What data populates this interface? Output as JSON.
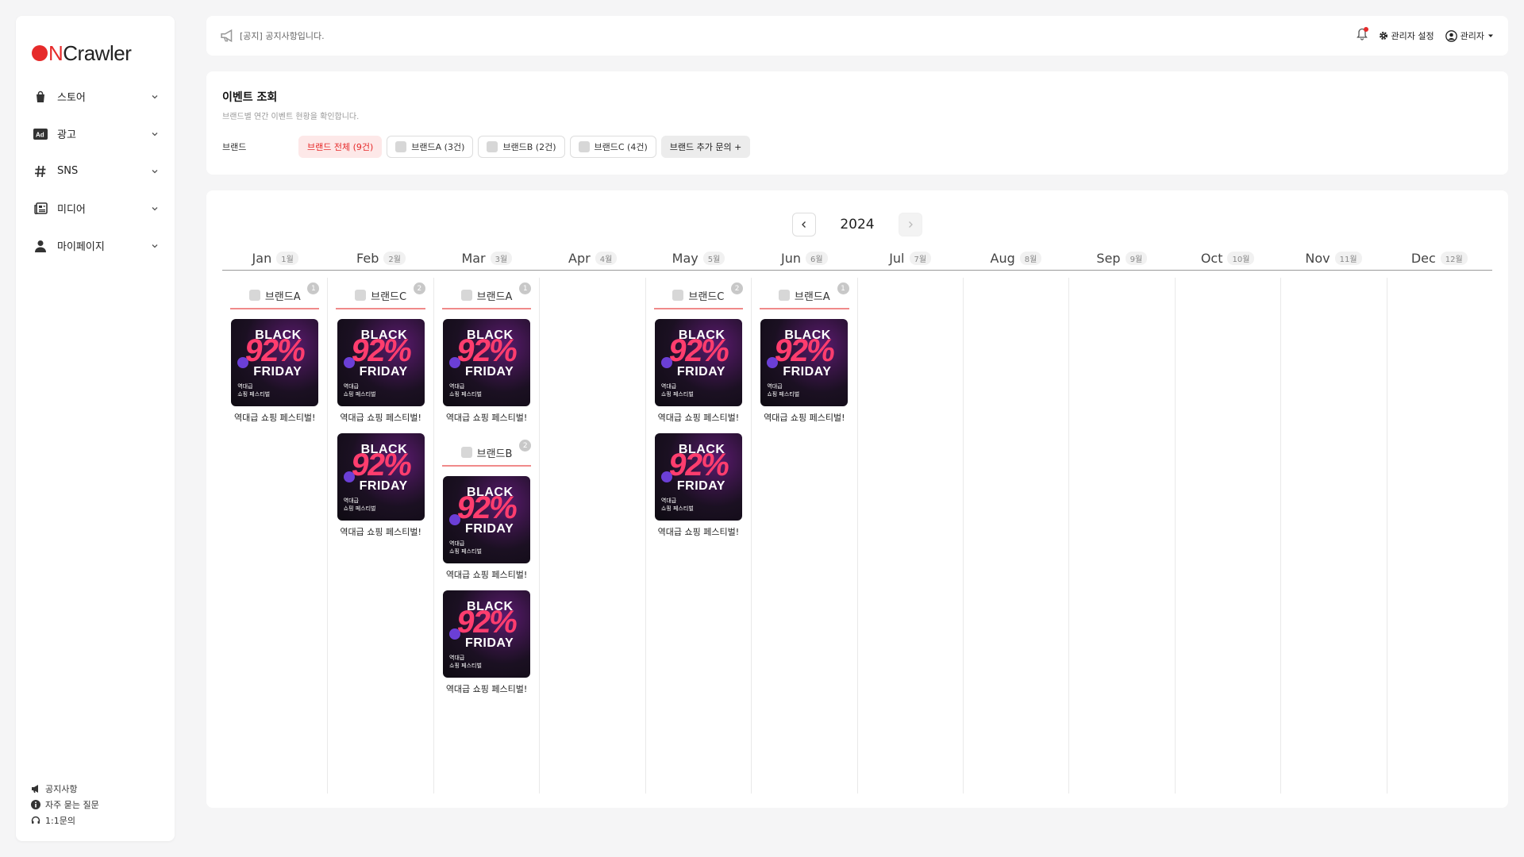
{
  "logo": {
    "n": "N",
    "rest": "Crawler"
  },
  "sidebar": {
    "items": [
      {
        "label": "스토어",
        "icon": "shopping-bag-icon"
      },
      {
        "label": "광고",
        "icon": "ad-icon"
      },
      {
        "label": "SNS",
        "icon": "hashtag-icon"
      },
      {
        "label": "미디어",
        "icon": "newspaper-icon"
      },
      {
        "label": "마이페이지",
        "icon": "user-icon"
      }
    ],
    "footer": [
      {
        "label": "공지사항",
        "icon": "megaphone-icon"
      },
      {
        "label": "자주 묻는 질문",
        "icon": "info-icon"
      },
      {
        "label": "1:1문의",
        "icon": "headset-icon"
      }
    ]
  },
  "topbar": {
    "notice": "[공지] 공지사항입니다.",
    "settings": "관리자 설정",
    "user": "관리자"
  },
  "filter": {
    "title": "이벤트 조회",
    "subtitle": "브랜드별 연간 이벤트 현황을 확인합니다.",
    "label": "브랜드",
    "chips": [
      "브랜드 전체 (9건)",
      "브랜드A (3건)",
      "브랜드B (2건)",
      "브랜드C (4건)"
    ],
    "add_inquiry": "브랜드 추가 문의 +"
  },
  "calendar": {
    "year": "2024",
    "months": [
      {
        "en": "Jan",
        "ko": "1월"
      },
      {
        "en": "Feb",
        "ko": "2월"
      },
      {
        "en": "Mar",
        "ko": "3월"
      },
      {
        "en": "Apr",
        "ko": "4월"
      },
      {
        "en": "May",
        "ko": "5월"
      },
      {
        "en": "Jun",
        "ko": "6월"
      },
      {
        "en": "Jul",
        "ko": "7월"
      },
      {
        "en": "Aug",
        "ko": "8월"
      },
      {
        "en": "Sep",
        "ko": "9월"
      },
      {
        "en": "Oct",
        "ko": "10월"
      },
      {
        "en": "Nov",
        "ko": "11월"
      },
      {
        "en": "Dec",
        "ko": "12월"
      }
    ],
    "groups": [
      {
        "month": 0,
        "brand": "브랜드A",
        "count": "1",
        "events": 1
      },
      {
        "month": 1,
        "brand": "브랜드C",
        "count": "2",
        "events": 2
      },
      {
        "month": 2,
        "brand": "브랜드A",
        "count": "1",
        "events": 1
      },
      {
        "month": 2,
        "brand": "브랜드B",
        "count": "2",
        "events": 2
      },
      {
        "month": 4,
        "brand": "브랜드C",
        "count": "2",
        "events": 2
      },
      {
        "month": 5,
        "brand": "브랜드A",
        "count": "1",
        "events": 1
      }
    ],
    "event_title": "역대급 쇼핑 페스티벌!",
    "thumb": {
      "line1": "BLACK",
      "pct": "92%",
      "line2": "FRIDAY",
      "sub1": "역대급",
      "sub2": "쇼핑 페스티벌"
    }
  },
  "colors": {
    "accent": "#e62a2a",
    "chip_active_bg": "#fde8e8",
    "brand_underline": "#f08a8a"
  }
}
